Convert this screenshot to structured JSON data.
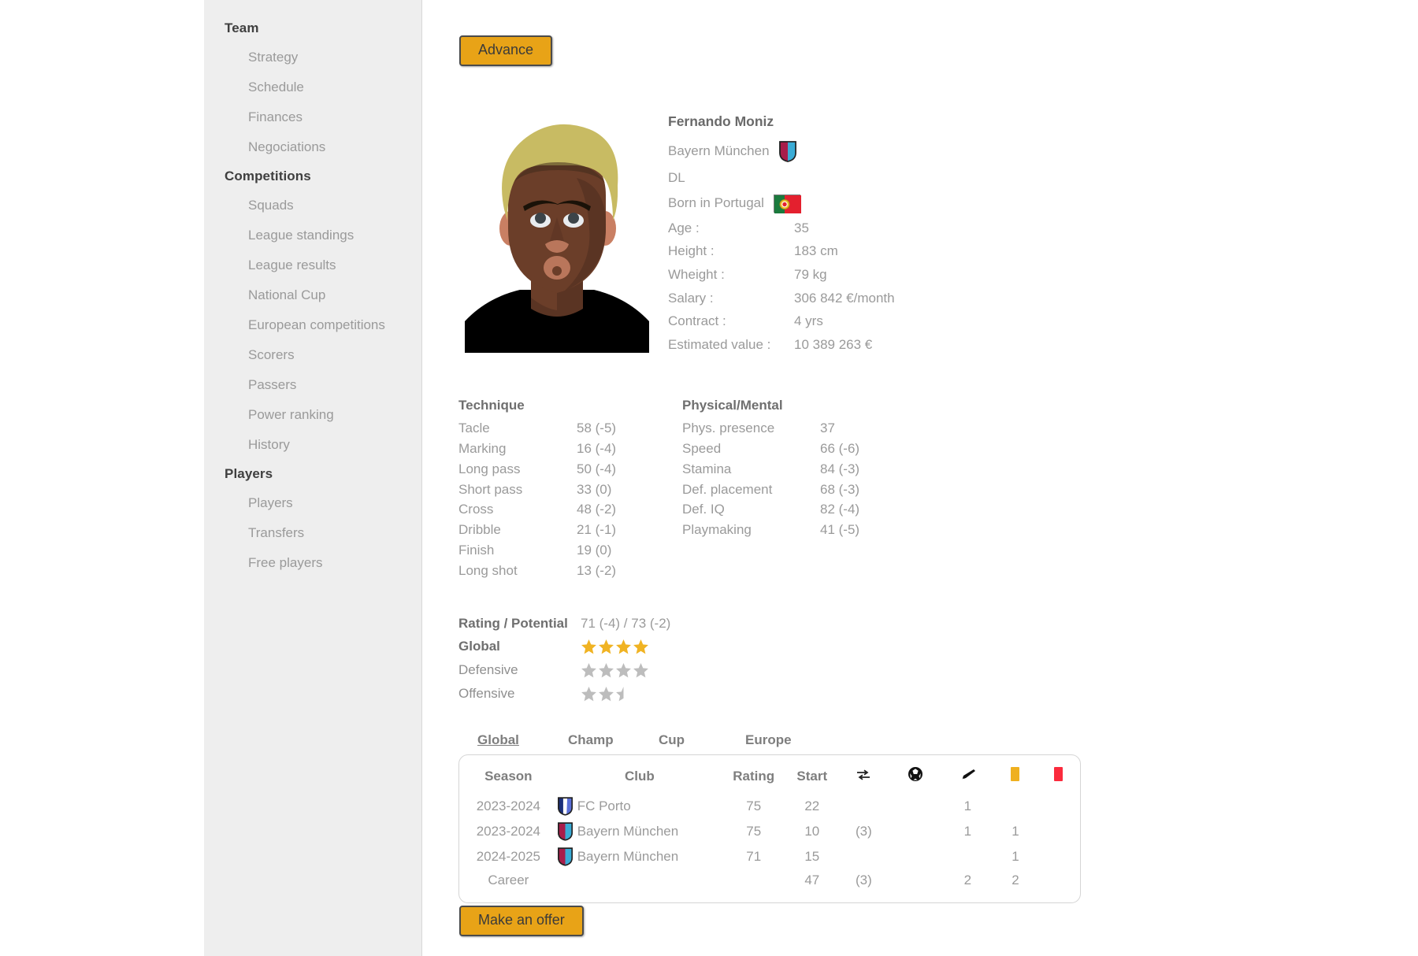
{
  "sidebar": {
    "groups": [
      {
        "title": "Team",
        "items": [
          {
            "label": "Strategy"
          },
          {
            "label": "Schedule"
          },
          {
            "label": "Finances"
          },
          {
            "label": "Negociations"
          }
        ]
      },
      {
        "title": "Competitions",
        "items": [
          {
            "label": "Squads"
          },
          {
            "label": "League standings"
          },
          {
            "label": "League results"
          },
          {
            "label": "National Cup"
          },
          {
            "label": "European competitions"
          },
          {
            "label": "Scorers"
          },
          {
            "label": "Passers"
          },
          {
            "label": "Power ranking"
          },
          {
            "label": "History"
          }
        ]
      },
      {
        "title": "Players",
        "items": [
          {
            "label": "Players"
          },
          {
            "label": "Transfers"
          },
          {
            "label": "Free players"
          }
        ]
      }
    ]
  },
  "toolbar": {
    "advance_label": "Advance",
    "offer_label": "Make an offer"
  },
  "player": {
    "name": "Fernando Moniz",
    "club": "Bayern München",
    "position": "DL",
    "birthplace": "Born in Portugal",
    "rows": [
      {
        "label": "Age :",
        "value": "35"
      },
      {
        "label": "Height :",
        "value": "183 cm"
      },
      {
        "label": "Wheight :",
        "value": "79 kg"
      },
      {
        "label": "Salary :",
        "value": "306 842 €/month"
      },
      {
        "label": "Contract :",
        "value": "4 yrs"
      },
      {
        "label": "Estimated value :",
        "value": "10 389 263 €"
      }
    ]
  },
  "technique": {
    "title": "Technique",
    "rows": [
      {
        "name": "Tacle",
        "value": "58 (-5)"
      },
      {
        "name": "Marking",
        "value": "16 (-4)"
      },
      {
        "name": "Long pass",
        "value": "50 (-4)"
      },
      {
        "name": "Short pass",
        "value": "33 (0)"
      },
      {
        "name": "Cross",
        "value": "48 (-2)"
      },
      {
        "name": "Dribble",
        "value": "21 (-1)"
      },
      {
        "name": "Finish",
        "value": "19 (0)"
      },
      {
        "name": "Long shot",
        "value": "13 (-2)"
      }
    ]
  },
  "physical": {
    "title": "Physical/Mental",
    "rows": [
      {
        "name": "Phys. presence",
        "value": "37"
      },
      {
        "name": "Speed",
        "value": "66 (-6)"
      },
      {
        "name": "Stamina",
        "value": "84 (-3)"
      },
      {
        "name": "Def. placement",
        "value": "68 (-3)"
      },
      {
        "name": "Def. IQ",
        "value": "82 (-4)"
      },
      {
        "name": "Playmaking",
        "value": "41 (-5)"
      }
    ]
  },
  "ratings": {
    "rating_label": "Rating / Potential",
    "rating_value": "71 (-4) / 73 (-2)",
    "global_label": "Global",
    "global_stars": 4,
    "global_total": 4,
    "defensive_label": "Defensive",
    "defensive_stars": 0,
    "defensive_total": 4,
    "offensive_label": "Offensive",
    "offensive_stars": 0,
    "offensive_total": 2.5,
    "star_gold": "#f0b323",
    "star_grey": "#bdbdbd"
  },
  "career": {
    "tabs": [
      {
        "label": "Global",
        "active": true
      },
      {
        "label": "Champ",
        "active": false
      },
      {
        "label": "Cup",
        "active": false
      },
      {
        "label": "Europe",
        "active": false
      }
    ],
    "headers": {
      "season": "Season",
      "club": "Club",
      "rating": "Rating",
      "start": "Start",
      "sub": "substitution-icon",
      "goal": "ball-icon",
      "assist": "boot-icon",
      "yellow": "yellow-card-icon",
      "red": "red-card-icon"
    },
    "rows": [
      {
        "season": "2023-2024",
        "club": "FC Porto",
        "badge": "porto",
        "rating": "75",
        "start": "22",
        "sub": "",
        "goal": "",
        "assist": "1",
        "yellow": "",
        "red": ""
      },
      {
        "season": "2023-2024",
        "club": "Bayern München",
        "badge": "bayern",
        "rating": "75",
        "start": "10",
        "sub": "(3)",
        "goal": "",
        "assist": "1",
        "yellow": "1",
        "red": ""
      },
      {
        "season": "2024-2025",
        "club": "Bayern München",
        "badge": "bayern",
        "rating": "71",
        "start": "15",
        "sub": "",
        "goal": "",
        "assist": "",
        "yellow": "1",
        "red": ""
      },
      {
        "season": "Career",
        "club": "",
        "badge": "",
        "rating": "",
        "start": "47",
        "sub": "(3)",
        "goal": "",
        "assist": "2",
        "yellow": "2",
        "red": ""
      }
    ]
  },
  "colors": {
    "accent": "#e8a317",
    "sidebar_bg": "#eeeeee",
    "yellow_card": "#efb01f",
    "red_card": "#fb2b3d",
    "bayern_left": "#a81d4a",
    "bayern_right": "#3aacd6",
    "porto_left": "#1b2f7a",
    "porto_right": "#5a6fd8"
  }
}
